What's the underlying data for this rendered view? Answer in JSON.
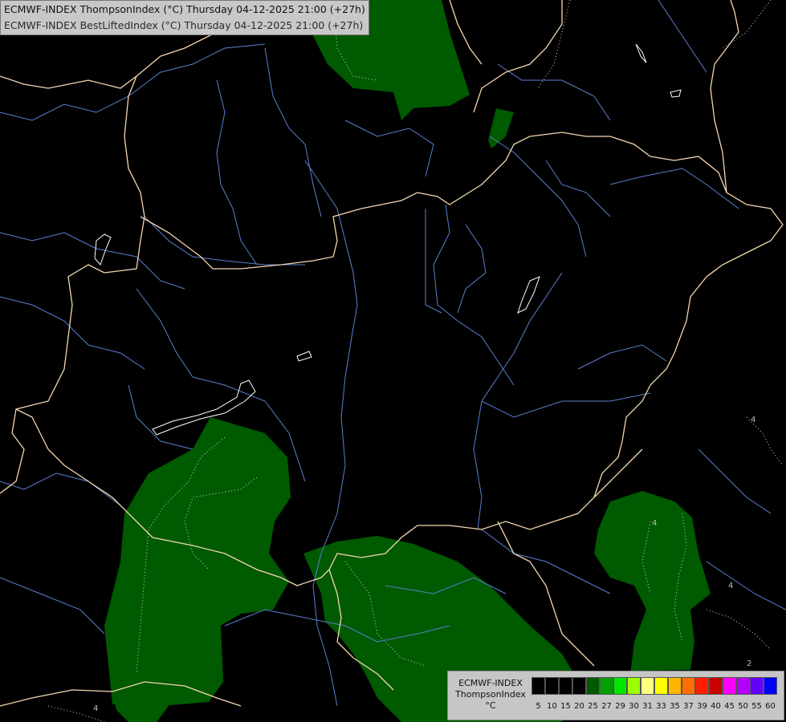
{
  "title": {
    "line1": "ECMWF-INDEX ThompsonIndex (°C) Thursday 04-12-2025 21:00 (+27h)",
    "line2": "ECMWF-INDEX BestLiftedIndex (°C) Thursday 04-12-2025 21:00 (+27h)"
  },
  "legend": {
    "line1": "ECMWF-INDEX",
    "line2": "ThompsonIndex",
    "line3": "°C",
    "bins": [
      {
        "label": "5",
        "color": "#000000"
      },
      {
        "label": "10",
        "color": "#000000"
      },
      {
        "label": "15",
        "color": "#000000"
      },
      {
        "label": "20",
        "color": "#000000"
      },
      {
        "label": "25",
        "color": "#005a00"
      },
      {
        "label": "27",
        "color": "#00a000"
      },
      {
        "label": "29",
        "color": "#00e600"
      },
      {
        "label": "30",
        "color": "#a0ff00"
      },
      {
        "label": "31",
        "color": "#ffff80"
      },
      {
        "label": "33",
        "color": "#ffff00"
      },
      {
        "label": "35",
        "color": "#ffb400"
      },
      {
        "label": "37",
        "color": "#ff6e00"
      },
      {
        "label": "39",
        "color": "#ff1e00"
      },
      {
        "label": "40",
        "color": "#c80000"
      },
      {
        "label": "45",
        "color": "#ff00ff"
      },
      {
        "label": "50",
        "color": "#b400ff"
      },
      {
        "label": "55",
        "color": "#6400ff"
      },
      {
        "label": "60",
        "color": "#0000ff"
      }
    ]
  },
  "contour_labels": [
    "4",
    "4",
    "4",
    "2",
    "4"
  ],
  "colors": {
    "background": "#000000",
    "fill": "#005a00",
    "border": "#f5d6b0",
    "river": "#5a7fd0",
    "lake": "#ffffff"
  }
}
